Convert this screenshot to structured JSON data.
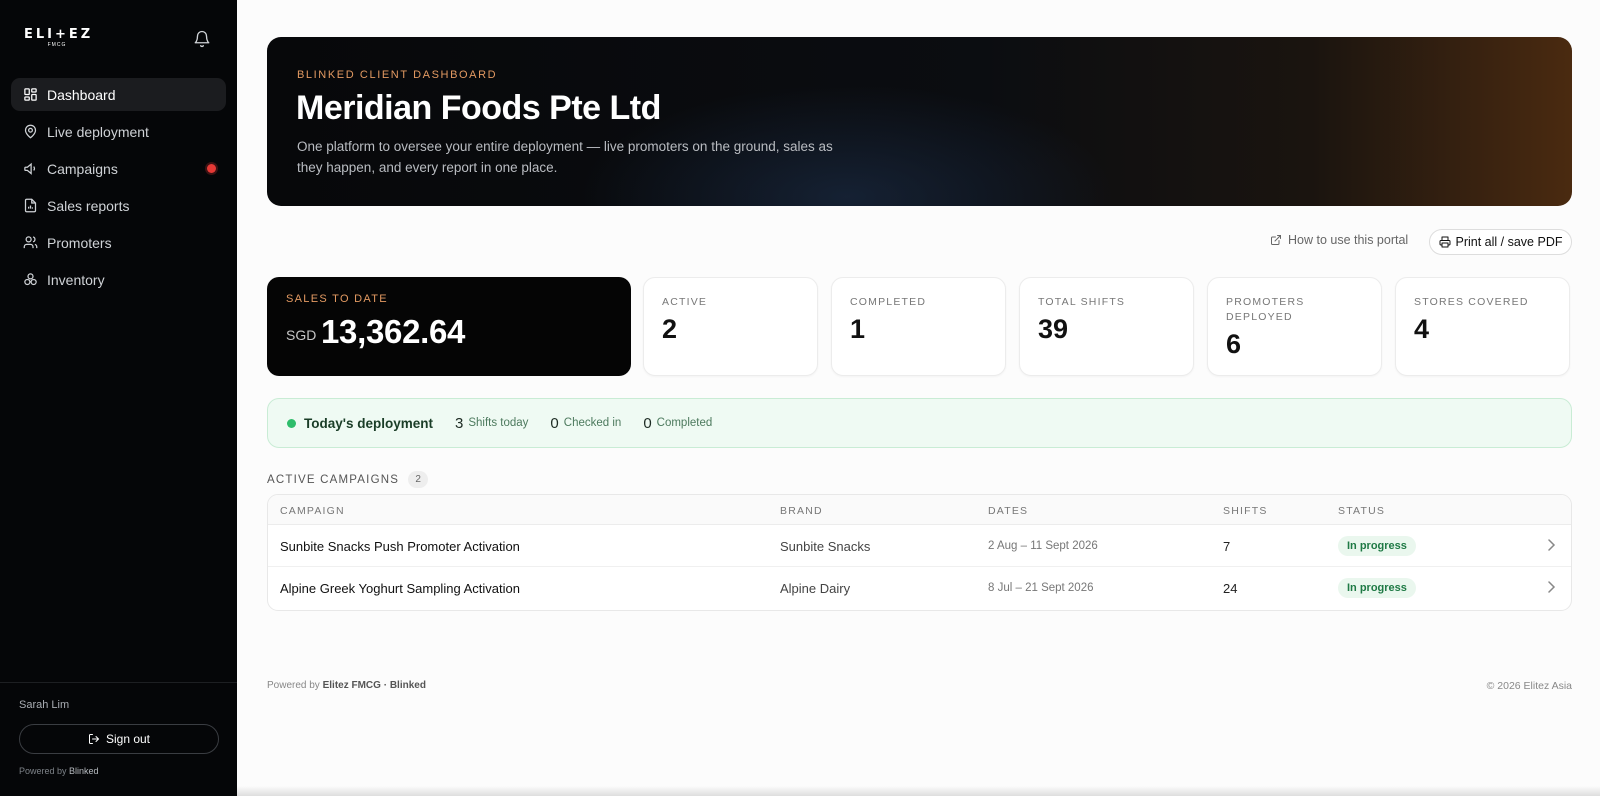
{
  "brand": {
    "logo_word": "ELI+EZ",
    "logo_sub": "FMCG"
  },
  "sidebar": {
    "items": [
      {
        "label": "Dashboard",
        "icon": "dashboard-icon",
        "active": true
      },
      {
        "label": "Live deployment",
        "icon": "map-pin-icon"
      },
      {
        "label": "Campaigns",
        "icon": "megaphone-icon",
        "notification": true
      },
      {
        "label": "Sales reports",
        "icon": "file-chart-icon"
      },
      {
        "label": "Promoters",
        "icon": "users-icon"
      },
      {
        "label": "Inventory",
        "icon": "boxes-icon"
      }
    ],
    "user_name": "Sarah Lim",
    "signout_label": "Sign out",
    "powered_prefix": "Powered by",
    "powered_brand": "Blinked"
  },
  "hero": {
    "eyebrow": "BLINKED CLIENT DASHBOARD",
    "title": "Meridian Foods Pte Ltd",
    "description": "One platform to oversee your entire deployment — live promoters on the ground, sales as they happen, and every report in one place."
  },
  "toolbar": {
    "help_link": "How to use this portal",
    "print_label": "Print all / save PDF"
  },
  "stats": {
    "sales": {
      "label": "SALES TO DATE",
      "currency": "SGD",
      "value": "13,362.64"
    },
    "cards": [
      {
        "label": "ACTIVE",
        "value": "2"
      },
      {
        "label": "COMPLETED",
        "value": "1"
      },
      {
        "label": "TOTAL SHIFTS",
        "value": "39"
      },
      {
        "label": "PROMOTERS DEPLOYED",
        "value": "6"
      },
      {
        "label": "STORES COVERED",
        "value": "4"
      }
    ]
  },
  "deployment": {
    "title": "Today's deployment",
    "shifts_value": "3",
    "shifts_label": "Shifts today",
    "checked_value": "0",
    "checked_label": "Checked in",
    "completed_value": "0",
    "completed_label": "Completed"
  },
  "campaigns": {
    "title": "ACTIVE CAMPAIGNS",
    "count": "2",
    "columns": [
      "CAMPAIGN",
      "BRAND",
      "DATES",
      "SHIFTS",
      "STATUS"
    ],
    "rows": [
      {
        "campaign": "Sunbite Snacks Push Promoter Activation",
        "brand": "Sunbite Snacks",
        "dates": "2 Aug – 11 Sept 2026",
        "shifts": "7",
        "status": "In progress"
      },
      {
        "campaign": "Alpine Greek Yoghurt Sampling Activation",
        "brand": "Alpine Dairy",
        "dates": "8 Jul – 21 Sept 2026",
        "shifts": "24",
        "status": "In progress"
      }
    ]
  },
  "footer": {
    "powered_prefix": "Powered by",
    "powered_brand": "Elitez FMCG · Blinked",
    "copyright": "© 2026 Elitez Asia"
  },
  "colors": {
    "accent": "#e39a62",
    "success": "#2ebd6b",
    "notification": "#e53935"
  }
}
